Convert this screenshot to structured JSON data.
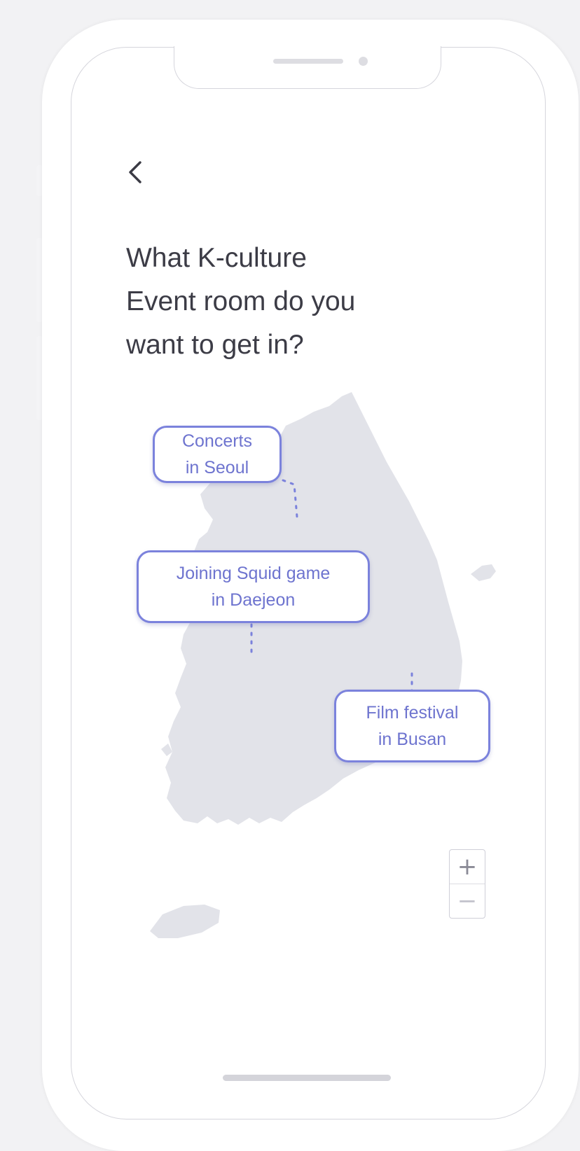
{
  "screen": {
    "question": {
      "line1": "What K-culture",
      "line2": "Event room do you",
      "line3": "want to get in?"
    },
    "events": [
      {
        "line1": "Concerts",
        "line2": "in Seoul"
      },
      {
        "line1": "Joining Squid game",
        "line2": "in Daejeon"
      },
      {
        "line1": "Film festival",
        "line2": "in Busan"
      }
    ],
    "zoom": {
      "in_label": "+",
      "out_label": "−"
    }
  },
  "colors": {
    "accent": "#7b82dc",
    "accent_text": "#6e74cf",
    "map_fill": "#e2e3e9",
    "heading_text": "#3c3c46"
  },
  "icons": {
    "back": "chevron-left-icon",
    "zoom_in": "plus-icon",
    "zoom_out": "minus-icon"
  }
}
